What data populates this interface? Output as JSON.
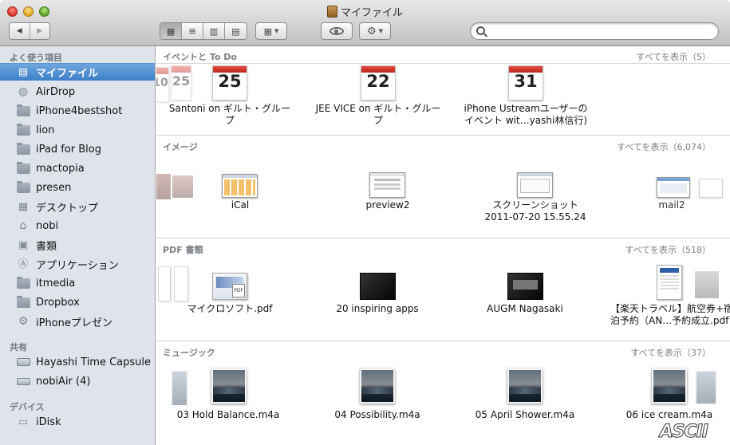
{
  "window": {
    "title": "マイファイル"
  },
  "sidebar": {
    "favorites_header": "よく使う項目",
    "favorites": [
      {
        "label": "マイファイル",
        "icon": "all-my-files-icon",
        "selected": true
      },
      {
        "label": "AirDrop",
        "icon": "airdrop-icon"
      },
      {
        "label": "iPhone4bestshot",
        "icon": "folder-icon"
      },
      {
        "label": "lion",
        "icon": "folder-icon"
      },
      {
        "label": "iPad for Blog",
        "icon": "folder-icon"
      },
      {
        "label": "mactopia",
        "icon": "folder-icon"
      },
      {
        "label": "presen",
        "icon": "folder-icon"
      },
      {
        "label": "デスクトップ",
        "icon": "desktop-icon"
      },
      {
        "label": "nobi",
        "icon": "home-icon"
      },
      {
        "label": "書類",
        "icon": "documents-icon"
      },
      {
        "label": "アプリケーション",
        "icon": "applications-icon"
      },
      {
        "label": "itmedia",
        "icon": "folder-icon"
      },
      {
        "label": "Dropbox",
        "icon": "folder-icon"
      },
      {
        "label": "iPhoneプレゼン",
        "icon": "gear-icon"
      }
    ],
    "shared_header": "共有",
    "shared": [
      {
        "label": "Hayashi Time Capsule",
        "icon": "time-capsule-icon"
      },
      {
        "label": "nobiAir (4)",
        "icon": "laptop-icon"
      }
    ],
    "devices_header": "デバイス",
    "devices": [
      {
        "label": "iDisk",
        "icon": "idisk-icon"
      }
    ]
  },
  "sections": {
    "events": {
      "title": "イベントと To Do",
      "show_all": "すべてを表示（5）",
      "items": [
        {
          "line1": "Santoni on ギルト・グルー",
          "line2": "プ",
          "day": "25"
        },
        {
          "line1": "JEE VICE on ギルト・グルー",
          "line2": "プ",
          "day": "22"
        },
        {
          "line1": "iPhone Ustreamユーザーの",
          "line2": "イベント wit…yashi林信行)",
          "day": "31"
        }
      ]
    },
    "images": {
      "title": "イメージ",
      "show_all": "すべてを表示（6,074）",
      "items": [
        {
          "line1": "iCal",
          "line2": ""
        },
        {
          "line1": "preview2",
          "line2": ""
        },
        {
          "line1": "スクリーンショット",
          "line2": "2011-07-20 15.55.24"
        },
        {
          "line1": "mail2",
          "line2": ""
        }
      ]
    },
    "pdf": {
      "title": "PDF 書類",
      "show_all": "すべてを表示（518）",
      "items": [
        {
          "line1": "マイクロソフト.pdf",
          "line2": ""
        },
        {
          "line1": "20 inspiring apps",
          "line2": ""
        },
        {
          "line1": "AUGM Nagasaki",
          "line2": ""
        },
        {
          "line1": "【楽天トラベル】航空券+宿",
          "line2": "泊予約（AN…予約成立.pdf"
        }
      ]
    },
    "music": {
      "title": "ミュージック",
      "show_all": "すべてを表示（37）",
      "items": [
        {
          "line1": "03 Hold Balance.m4a"
        },
        {
          "line1": "04 Possibility.m4a"
        },
        {
          "line1": "05 April Shower.m4a"
        },
        {
          "line1": "06 ice cream.m4a"
        }
      ]
    }
  },
  "watermark": "ASCII",
  "colors": {
    "selection": "#3d7fc9",
    "sidebar_bg": "#dfe4ea",
    "section_title": "#7a7f86"
  }
}
